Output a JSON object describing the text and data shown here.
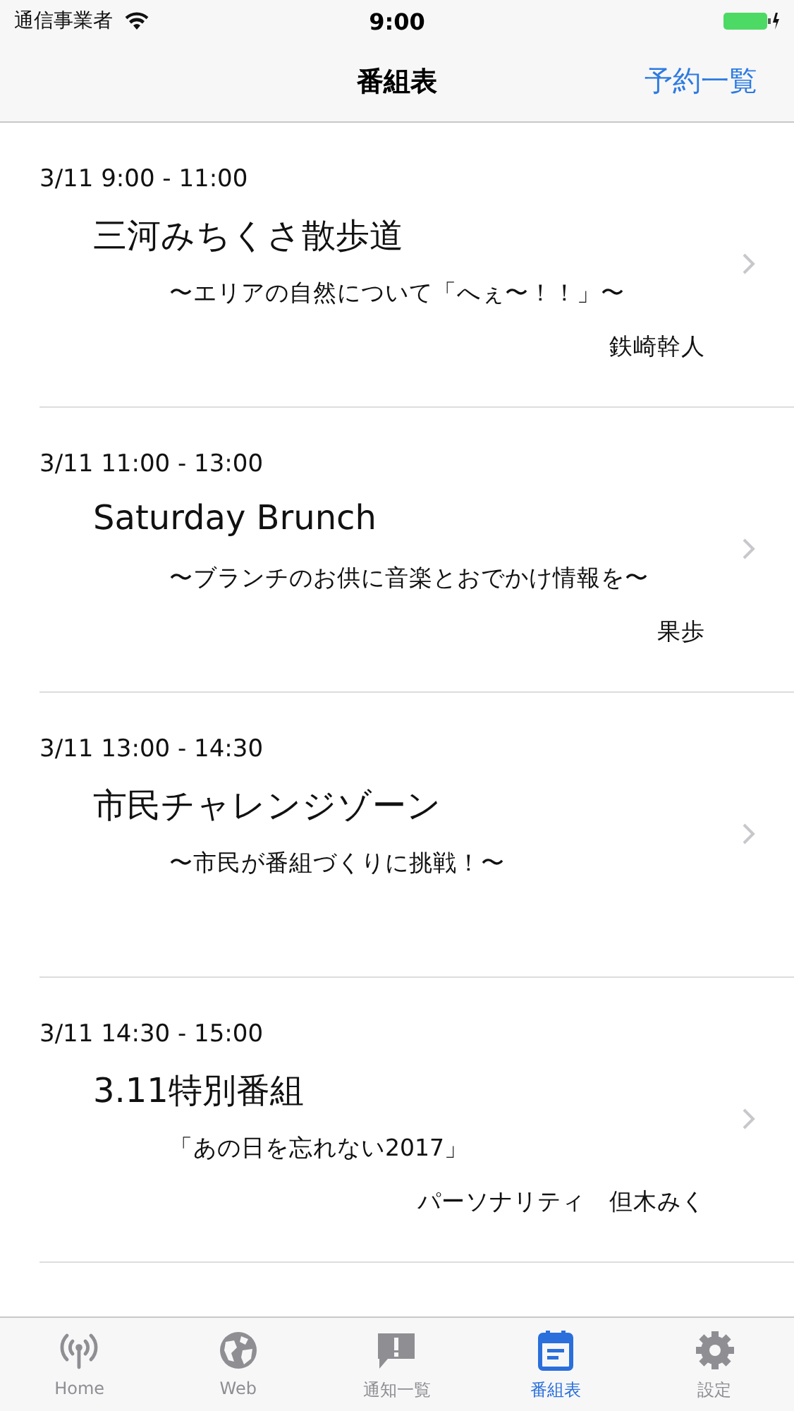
{
  "status_bar": {
    "carrier": "通信事業者",
    "time": "9:00"
  },
  "nav_bar": {
    "title": "番組表",
    "right_button": "予約一覧"
  },
  "programs": [
    {
      "time": "3/11 9:00 - 11:00",
      "title": "三河みちくさ散歩道",
      "subtitle": "〜エリアの自然について「へぇ〜！！」〜",
      "personality": "鉄崎幹人"
    },
    {
      "time": "3/11 11:00 - 13:00",
      "title": "Saturday Brunch",
      "subtitle": "〜ブランチのお供に音楽とおでかけ情報を〜",
      "personality": "果歩"
    },
    {
      "time": "3/11 13:00 - 14:30",
      "title": "市民チャレンジゾーン",
      "subtitle": "〜市民が番組づくりに挑戦！〜"
    },
    {
      "time": "3/11 14:30 - 15:00",
      "title": "3.11特別番組",
      "subtitle": "「あの日を忘れない2017」",
      "personality": "パーソナリティ　但木みく"
    }
  ],
  "tab_bar": [
    {
      "kind": "antenna",
      "label": "Home",
      "selected": false
    },
    {
      "kind": "globe",
      "label": "Web",
      "selected": false
    },
    {
      "kind": "alert",
      "label": "通知一覧",
      "selected": false
    },
    {
      "kind": "calendar",
      "label": "番組表",
      "selected": true
    },
    {
      "kind": "gear",
      "label": "設定",
      "selected": false
    }
  ]
}
